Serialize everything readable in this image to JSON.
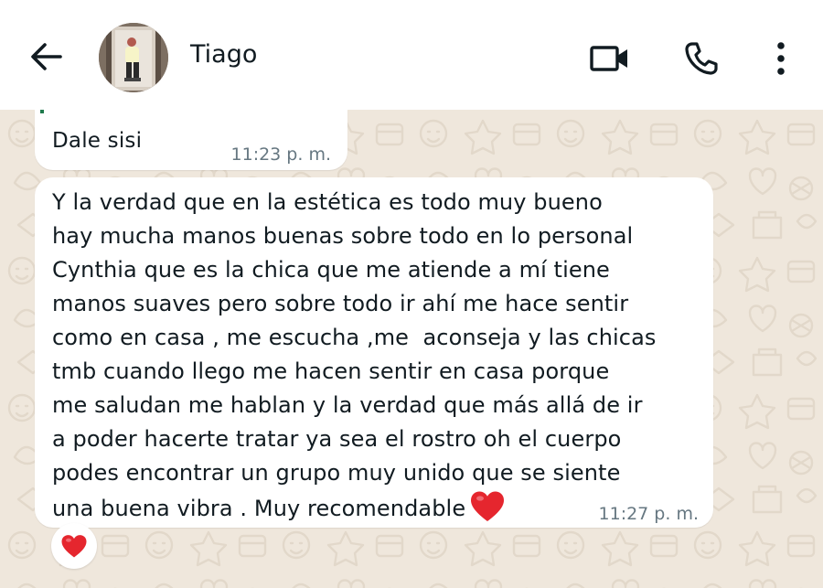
{
  "header": {
    "contact_name": "Tiago",
    "icons": {
      "back": "arrow-left-icon",
      "video": "video-camera-icon",
      "call": "phone-icon",
      "menu": "more-vertical-icon"
    }
  },
  "messages": [
    {
      "text": "Dale sisi",
      "time": "11:23 p. m."
    },
    {
      "lines": [
        "Y la verdad que en la estética es todo muy bueno",
        "hay mucha manos buenas sobre todo en lo personal",
        "Cynthia que es la chica que me atiende a mí tiene",
        "manos suaves pero sobre todo ir ahí me hace sentir",
        "como en casa , me escucha ,me  aconseja y las chicas",
        "tmb cuando llego me hacen sentir en casa porque",
        "me saludan me hablan y la verdad que más allá de ir",
        "a poder hacerte tratar ya sea el rostro oh el cuerpo",
        "podes encontrar un grupo muy unido que se siente",
        "una buena vibra . Muy recomendable"
      ],
      "emoji": "red-heart-icon",
      "time": "11:27 p. m.",
      "reaction": "red-heart-icon"
    }
  ],
  "colors": {
    "wallpaper": "#efe7dc",
    "bubble": "#ffffff",
    "text": "#111b21",
    "time": "#667781",
    "heart": "#e5262e"
  }
}
